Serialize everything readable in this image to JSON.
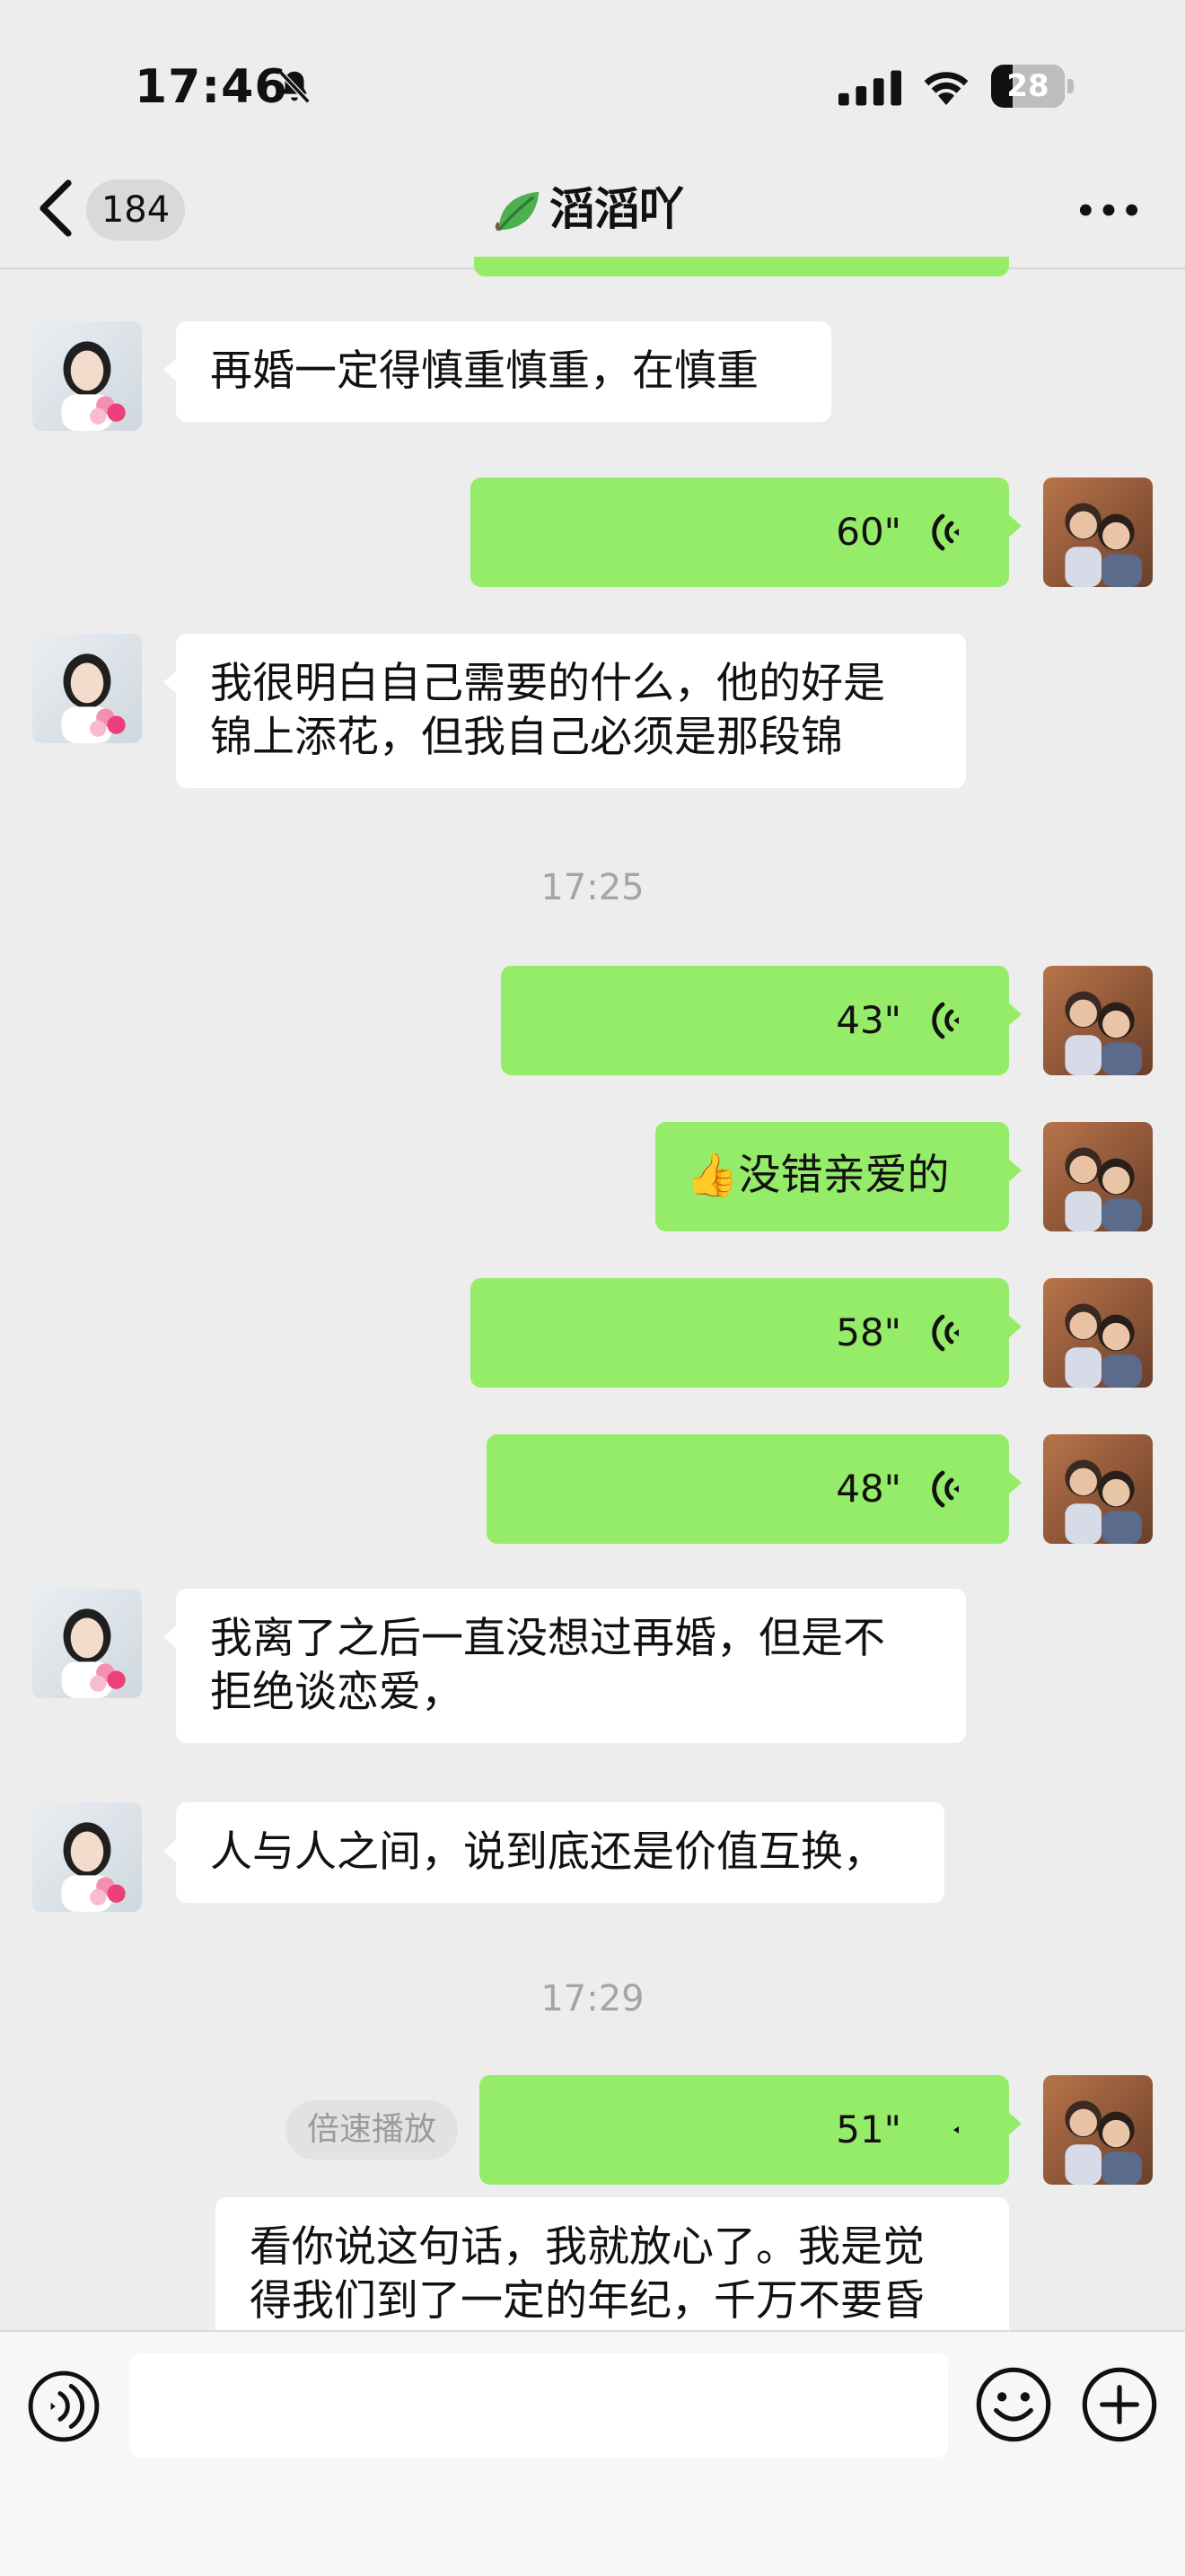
{
  "status_bar": {
    "time": "17:46",
    "battery": "28",
    "icons": [
      "bell-muted-icon",
      "signal-icon",
      "wifi-icon",
      "battery-icon"
    ]
  },
  "nav": {
    "unread_count": "184",
    "title": "滔滔吖",
    "icons": [
      "back-icon",
      "leaf-icon",
      "more-icon"
    ]
  },
  "messages": [
    {
      "kind": "text",
      "from": "them",
      "text": "再婚一定得慎重慎重，在慎重"
    },
    {
      "kind": "voice",
      "from": "me",
      "duration": "60\""
    },
    {
      "kind": "text",
      "from": "them",
      "lines": [
        "我很明白自己需要的什么，他的好是",
        "锦上添花，但我自己必须是那段锦"
      ]
    },
    {
      "kind": "time",
      "text": "17:25"
    },
    {
      "kind": "voice",
      "from": "me",
      "duration": "43\""
    },
    {
      "kind": "text",
      "from": "me",
      "emoji": "👍",
      "text": "没错亲爱的"
    },
    {
      "kind": "voice",
      "from": "me",
      "duration": "58\""
    },
    {
      "kind": "voice",
      "from": "me",
      "duration": "48\""
    },
    {
      "kind": "text",
      "from": "them",
      "lines": [
        "我离了之后一直没想过再婚，但是不",
        "拒绝谈恋爱，"
      ]
    },
    {
      "kind": "text",
      "from": "them",
      "text": "人与人之间，说到底还是价值互换，"
    },
    {
      "kind": "time",
      "text": "17:29"
    },
    {
      "kind": "voice",
      "from": "me",
      "duration": "51\"",
      "speed_label": "倍速播放"
    },
    {
      "kind": "text",
      "from": "them",
      "lines": [
        "看你说这句话，我就放心了。我是觉",
        "得我们到了一定的年纪，千万不要昏"
      ]
    }
  ],
  "colors": {
    "background": "#ededed",
    "bubble_out": "#95ec69",
    "bubble_in": "#ffffff",
    "timestamp": "#a5a5a5"
  },
  "input_bar": {
    "icons": [
      "voice-toggle-icon",
      "emoji-icon",
      "plus-icon"
    ]
  }
}
